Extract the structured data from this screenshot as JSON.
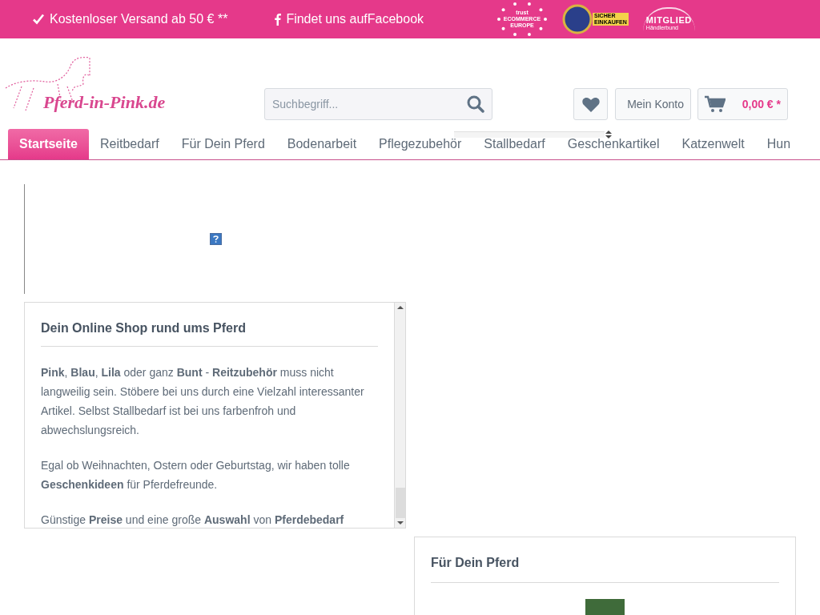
{
  "top_bar": {
    "items": [
      {
        "kind": "check",
        "text": "Kostenloser Versand ab 50 € **"
      },
      {
        "kind": "facebook",
        "text": "Findet uns aufFacebook"
      }
    ],
    "badges": [
      {
        "kind": "stars",
        "lines": [
          "trust",
          "ECOMMERCE",
          "EUROPE"
        ]
      },
      {
        "kind": "seal",
        "lines": [
          "SICHER",
          "EINKAUFEN"
        ]
      },
      {
        "kind": "member",
        "lines": [
          "MITGLIED",
          "Händlerbund"
        ]
      }
    ]
  },
  "logo": {
    "text": "Pferd-in-Pink.de"
  },
  "search": {
    "placeholder": "Suchbegriff..."
  },
  "account": {
    "label": "Mein Konto"
  },
  "cart": {
    "total": "0,00 € *"
  },
  "nav": [
    {
      "label": "Startseite",
      "selected": true
    },
    {
      "label": "Reitbedarf",
      "selected": false
    },
    {
      "label": "Für Dein Pferd",
      "selected": false
    },
    {
      "label": "Bodenarbeit",
      "selected": false
    },
    {
      "label": "Pflegezubehör",
      "selected": false
    },
    {
      "label": "Stallbedarf",
      "selected": false
    },
    {
      "label": "Geschenkartikel",
      "selected": false
    },
    {
      "label": "Katzenwelt",
      "selected": false
    },
    {
      "label": "Hun",
      "selected": false
    }
  ],
  "intro": {
    "title": "Dein Online Shop rund ums Pferd",
    "paragraphs": [
      "**Pink**, **Blau**, **Lila** oder ganz **Bunt** - **Reitzubehör** muss nicht langweilig sein. Stöbere bei uns durch eine Vielzahl interessanter Artikel. Selbst Stallbedarf ist bei uns farbenfroh und abwechslungsreich.",
      "Egal ob Weihnachten, Ostern oder Geburtstag, wir haben tolle **Geschenkideen** für Pferdefreunde.",
      "Günstige **Preise** und eine große **Auswahl** von **Pferdebedarf**"
    ]
  },
  "category_box": {
    "title": "Für Dein Pferd"
  }
}
